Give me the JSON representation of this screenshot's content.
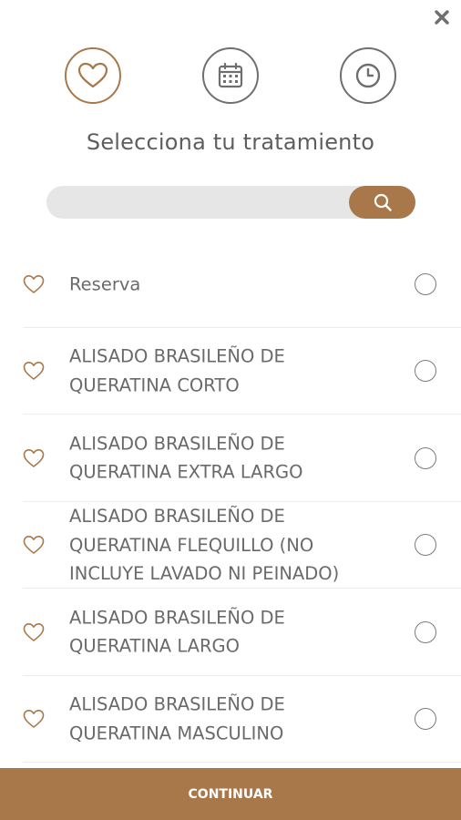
{
  "header": {
    "close_icon": "close-icon"
  },
  "steps": [
    {
      "icon": "heart-icon",
      "active": true
    },
    {
      "icon": "calendar-icon",
      "active": false
    },
    {
      "icon": "clock-icon",
      "active": false
    }
  ],
  "title": "Selecciona tu tratamiento",
  "search": {
    "value": "",
    "placeholder": "",
    "button_icon": "search-icon"
  },
  "treatments": [
    {
      "label": "Reserva",
      "selected": false
    },
    {
      "label": "ALISADO BRASILEÑO DE\nQUERATINA CORTO",
      "selected": false
    },
    {
      "label": "ALISADO BRASILEÑO DE\nQUERATINA EXTRA LARGO",
      "selected": false
    },
    {
      "label": "ALISADO BRASILEÑO DE\nQUERATINA FLEQUILLO (NO\nINCLUYE LAVADO NI PEINADO)",
      "selected": false
    },
    {
      "label": "ALISADO BRASILEÑO DE\nQUERATINA LARGO",
      "selected": false
    },
    {
      "label": "ALISADO BRASILEÑO DE\nQUERATINA MASCULINO",
      "selected": false
    }
  ],
  "continue_label": "CONTINUAR",
  "colors": {
    "accent": "#a9784a",
    "icon_gray": "#6f6f6f",
    "search_bg": "#e6e6e6"
  }
}
